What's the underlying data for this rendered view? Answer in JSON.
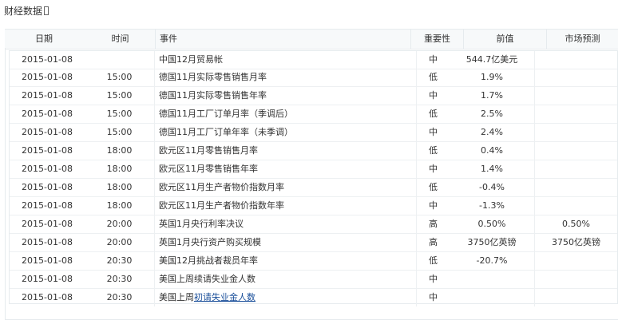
{
  "page": {
    "title": "财经数据"
  },
  "table": {
    "headers": {
      "date": "日期",
      "time": "时间",
      "event": "事件",
      "importance": "重要性",
      "previous": "前值",
      "forecast": "市场预测"
    },
    "rows": [
      {
        "date": "2015-01-08",
        "time": "",
        "event": "中国12月贸易帐",
        "importance": "中",
        "previous": "544.7亿美元",
        "forecast": ""
      },
      {
        "date": "2015-01-08",
        "time": "15:00",
        "event": "德国11月实际零售销售月率",
        "importance": "低",
        "previous": "1.9%",
        "forecast": ""
      },
      {
        "date": "2015-01-08",
        "time": "15:00",
        "event": "德国11月实际零售销售年率",
        "importance": "中",
        "previous": "1.7%",
        "forecast": ""
      },
      {
        "date": "2015-01-08",
        "time": "15:00",
        "event": "德国11月工厂订单月率（季调后）",
        "importance": "低",
        "previous": "2.5%",
        "forecast": ""
      },
      {
        "date": "2015-01-08",
        "time": "15:00",
        "event": "德国11月工厂订单年率（未季调）",
        "importance": "中",
        "previous": "2.4%",
        "forecast": ""
      },
      {
        "date": "2015-01-08",
        "time": "18:00",
        "event": "欧元区11月零售销售月率",
        "importance": "低",
        "previous": "0.4%",
        "forecast": ""
      },
      {
        "date": "2015-01-08",
        "time": "18:00",
        "event": "欧元区11月零售销售年率",
        "importance": "中",
        "previous": "1.4%",
        "forecast": ""
      },
      {
        "date": "2015-01-08",
        "time": "18:00",
        "event": "欧元区11月生产者物价指数月率",
        "importance": "低",
        "previous": "-0.4%",
        "forecast": ""
      },
      {
        "date": "2015-01-08",
        "time": "18:00",
        "event": "欧元区11月生产者物价指数年率",
        "importance": "中",
        "previous": "-1.3%",
        "forecast": ""
      },
      {
        "date": "2015-01-08",
        "time": "20:00",
        "event": "英国1月央行利率决议",
        "importance": "高",
        "previous": "0.50%",
        "forecast": "0.50%"
      },
      {
        "date": "2015-01-08",
        "time": "20:00",
        "event": "英国1月央行资产购买规模",
        "importance": "高",
        "previous": "3750亿英镑",
        "forecast": "3750亿英镑"
      },
      {
        "date": "2015-01-08",
        "time": "20:30",
        "event": "美国12月挑战者裁员年率",
        "importance": "低",
        "previous": "-20.7%",
        "forecast": ""
      },
      {
        "date": "2015-01-08",
        "time": "20:30",
        "event": "美国上周续请失业金人数",
        "importance": "中",
        "previous": "",
        "forecast": ""
      },
      {
        "date": "2015-01-08",
        "time": "20:30",
        "event_prefix": "美国上周",
        "event_link": "初请失业金人数",
        "importance": "中",
        "previous": "",
        "forecast": ""
      }
    ]
  },
  "colors": {
    "link": "#1a4f9a",
    "border": "#e6ebee",
    "header_bg": "#f7f9fa"
  }
}
